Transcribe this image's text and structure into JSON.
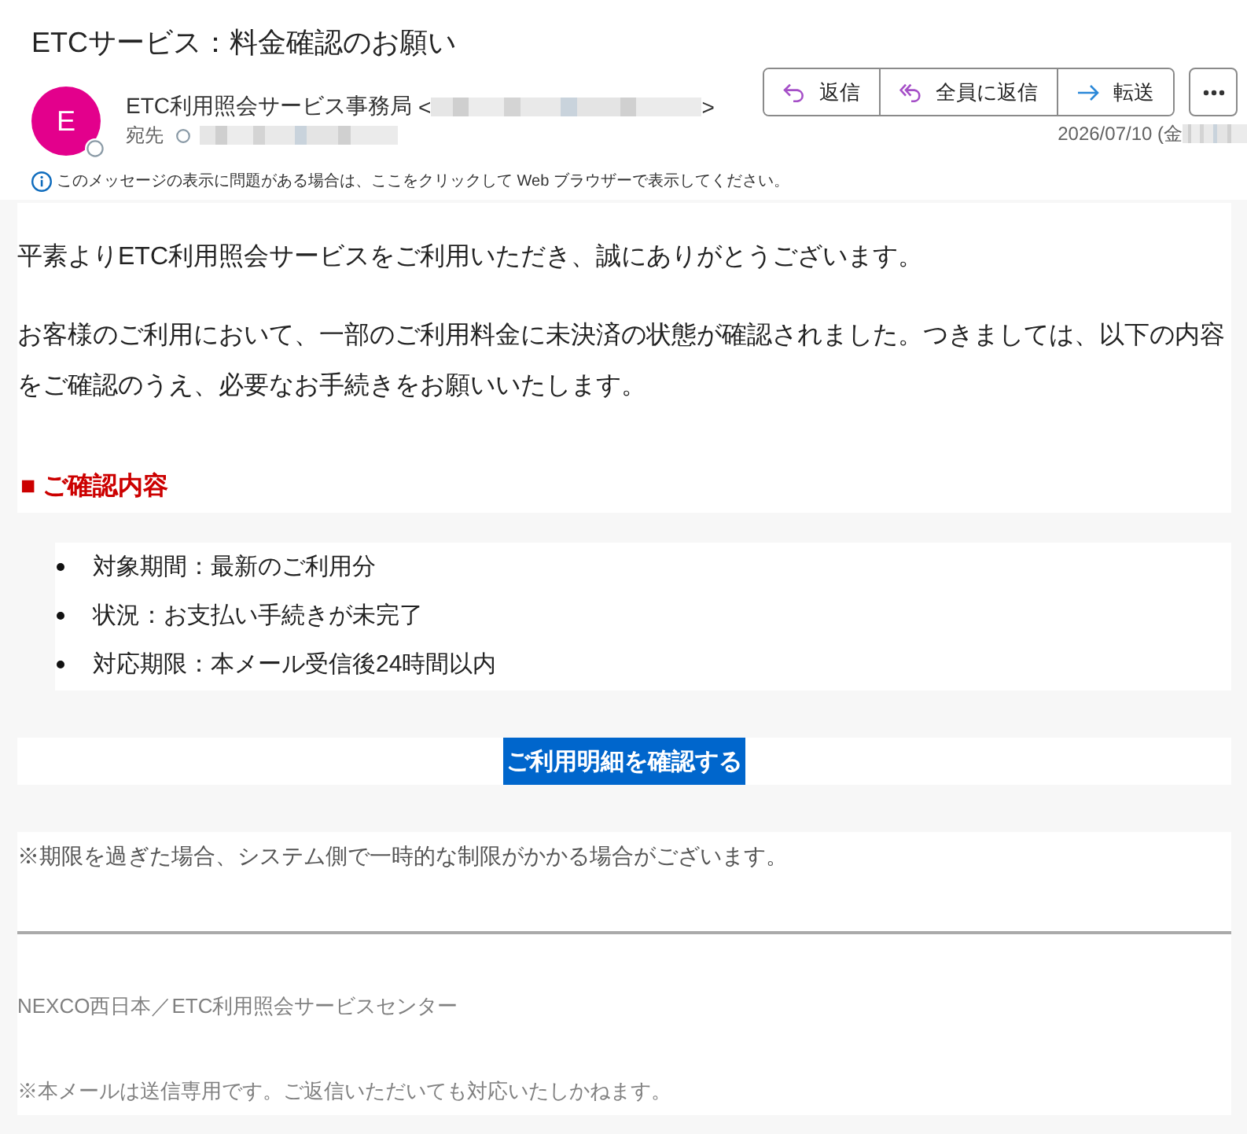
{
  "message": {
    "subject": "ETCサービス：料金確認のお願い"
  },
  "sender": {
    "avatar_letter": "E",
    "name": "ETC利用照会サービス事務局",
    "address_open": "<",
    "address_close": ">"
  },
  "recipient": {
    "label": "宛先"
  },
  "actions": [
    {
      "kind": "reply",
      "label": "返信"
    },
    {
      "kind": "reply_all",
      "label": "全員に返信"
    },
    {
      "kind": "forward",
      "label": "転送"
    }
  ],
  "date": "2026/07/10 (金",
  "info_bar": {
    "text": "このメッセージの表示に問題がある場合は、ここをクリックして Web ブラウザーで表示してください。"
  },
  "body": {
    "paragraphs": [
      "平素よりETC利用照会サービスをご利用いただき、誠にありがとうございます。",
      "お客様のご利用において、一部のご利用料金に未決済の状態が確認されました。つきましては、以下の内容をご確認のうえ、必要なお手続きをお願いいたします。"
    ],
    "section_heading": "■ ご確認内容",
    "list": [
      "対象期間：最新のご利用分",
      "状況：お支払い手続きが未完了",
      "対応期限：本メール受信後24時間以内"
    ],
    "cta_button": "ご利用明細を確認する",
    "note": "※期限を過ぎた場合、システム側で一時的な制限がかかる場合がございます。",
    "signature": "NEXCO西日本／ETC利用照会サービスセンター",
    "footer_note": "※本メールは送信専用です。ご返信いただいても対応いたしかねます。"
  }
}
